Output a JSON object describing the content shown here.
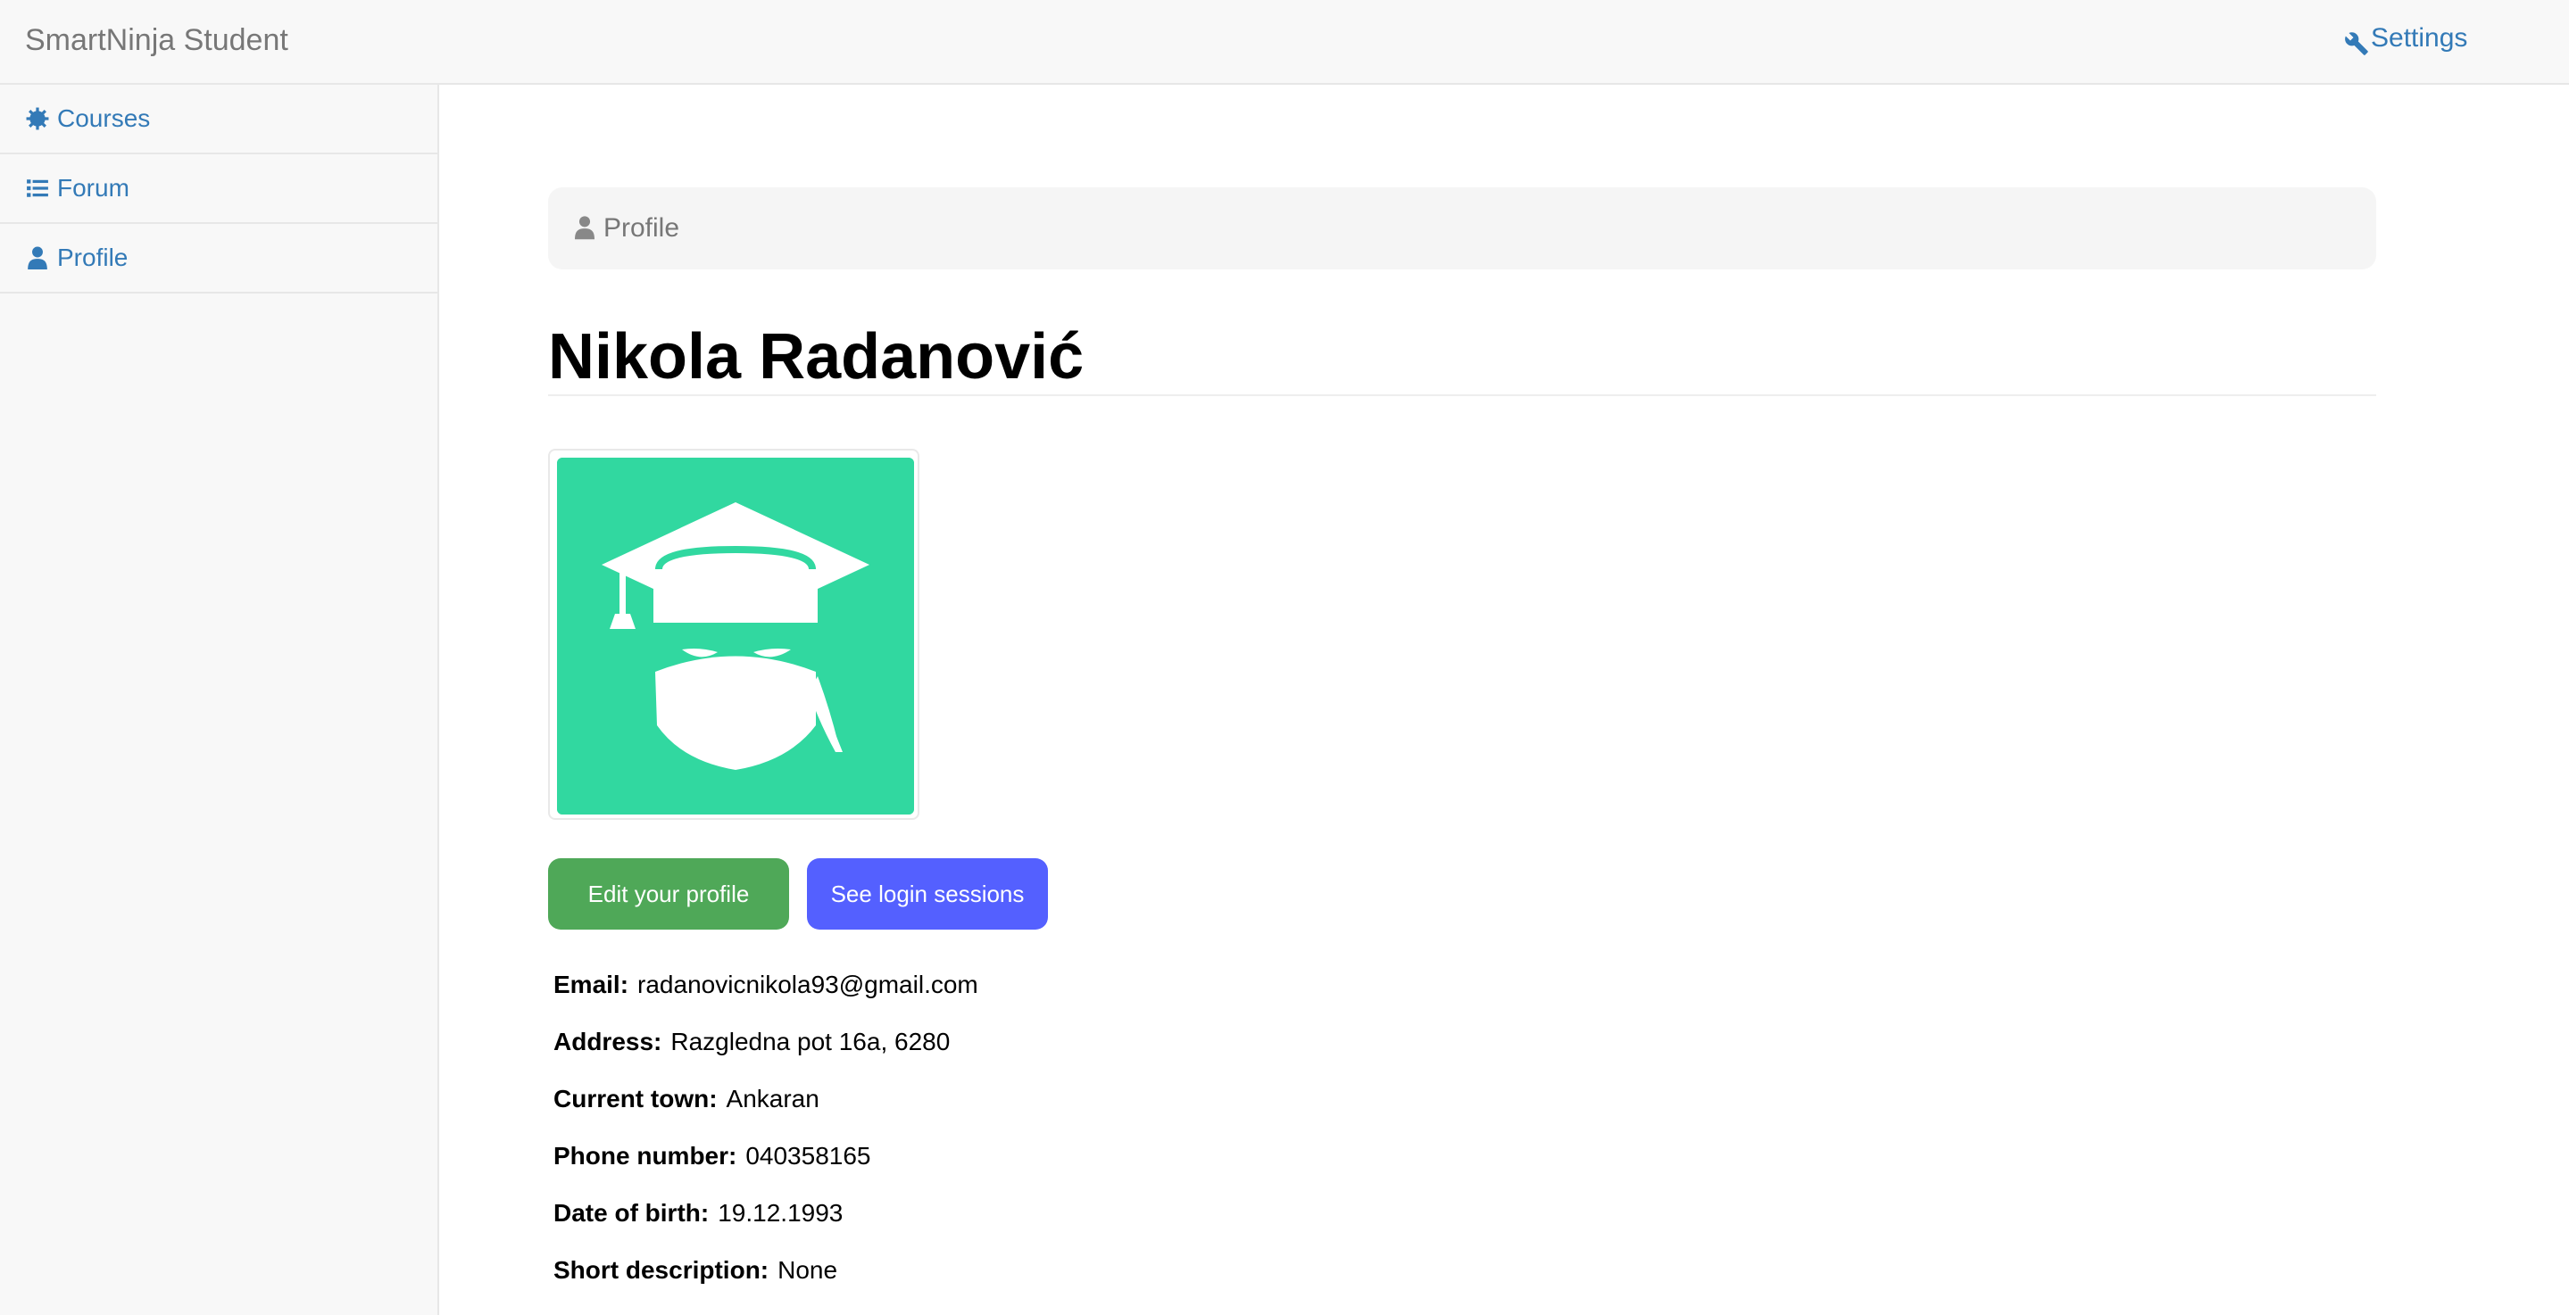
{
  "navbar": {
    "brand": "SmartNinja Student",
    "settings_label": "Settings",
    "settings_icon": "wrench-icon"
  },
  "sidebar": {
    "items": [
      {
        "label": "Courses",
        "icon": "gear-icon"
      },
      {
        "label": "Forum",
        "icon": "list-icon"
      },
      {
        "label": "Profile",
        "icon": "user-icon"
      }
    ]
  },
  "breadcrumb": {
    "label": "Profile",
    "icon": "user-icon"
  },
  "profile": {
    "name": "Nikola Radanović",
    "avatar_icon": "graduate-ninja-avatar",
    "avatar_color": "#31d8a0",
    "buttons": {
      "edit": "Edit your profile",
      "sessions": "See login sessions"
    },
    "fields": [
      {
        "label": "Email:",
        "value": "radanovicnikola93@gmail.com"
      },
      {
        "label": "Address:",
        "value": "Razgledna pot 16a, 6280"
      },
      {
        "label": "Current town:",
        "value": "Ankaran"
      },
      {
        "label": "Phone number:",
        "value": "040358165"
      },
      {
        "label": "Date of birth:",
        "value": "19.12.1993"
      },
      {
        "label": "Short description:",
        "value": "None"
      }
    ]
  },
  "colors": {
    "link": "#337ab7",
    "edit_button": "#4fa858",
    "sessions_button": "#5460ff"
  }
}
